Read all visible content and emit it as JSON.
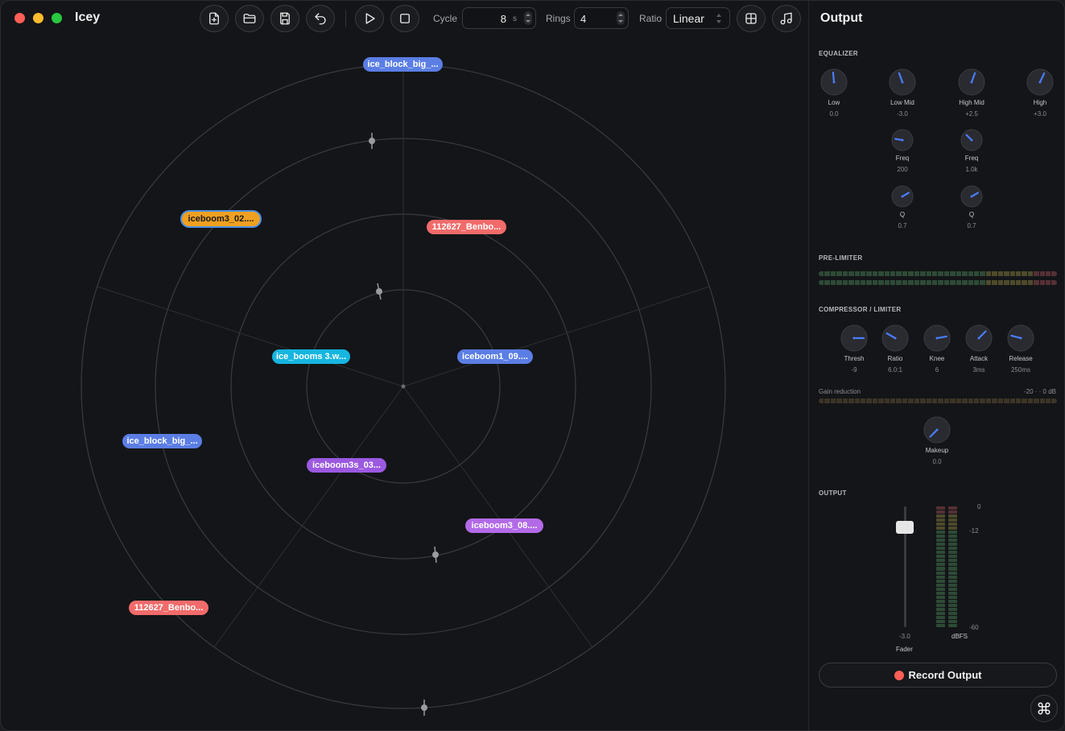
{
  "app": {
    "title": "Icey"
  },
  "toolbar": {
    "new_icon": "file-plus-icon",
    "open_icon": "folder-icon",
    "save_icon": "save-icon",
    "undo_icon": "undo-icon",
    "play_icon": "play-icon",
    "stop_icon": "stop-icon",
    "cycle_label": "Cycle",
    "cycle_value": "8",
    "cycle_unit": "s",
    "rings_label": "Rings",
    "rings_value": "4",
    "ratio_label": "Ratio",
    "ratio_value": "Linear",
    "grid_icon": "grid-icon",
    "music_icon": "music-note-icon"
  },
  "stage": {
    "samples": [
      {
        "label": "ice_block_big_...",
        "color": "#5b7ee5"
      },
      {
        "label": "iceboom3_02....",
        "color": "#f0a020",
        "selected": true
      },
      {
        "label": "112627_Benbo...",
        "color": "#f26b6b"
      },
      {
        "label": "ice_booms 3.w...",
        "color": "#15b6e0"
      },
      {
        "label": "iceboom1_09....",
        "color": "#5b7ee5"
      },
      {
        "label": "ice_block_big_...",
        "color": "#5b7ee5"
      },
      {
        "label": "iceboom3s_03...",
        "color": "#9b59e0"
      },
      {
        "label": "iceboom3_08....",
        "color": "#b36ae8"
      },
      {
        "label": "112627_Benbo...",
        "color": "#f26b6b"
      }
    ]
  },
  "output": {
    "title": "Output",
    "equalizer": {
      "label": "EQUALIZER",
      "knobs": [
        {
          "name": "Low",
          "value": "0.0"
        },
        {
          "name": "Low Mid",
          "value": "-3.0"
        },
        {
          "name": "High Mid",
          "value": "+2.5"
        },
        {
          "name": "High",
          "value": "+3.0"
        },
        {
          "name": "Freq",
          "value": "200"
        },
        {
          "name": "Freq",
          "value": "1.0k"
        },
        {
          "name": "Q",
          "value": "0.7"
        },
        {
          "name": "Q",
          "value": "0.7"
        }
      ]
    },
    "pre_limiter": {
      "label": "PRE-LIMITER"
    },
    "compressor": {
      "label": "COMPRESSOR / LIMITER",
      "knobs": [
        {
          "name": "Thresh",
          "value": "-9"
        },
        {
          "name": "Ratio",
          "value": "6.0:1"
        },
        {
          "name": "Knee",
          "value": "6"
        },
        {
          "name": "Attack",
          "value": "3ms"
        },
        {
          "name": "Release",
          "value": "250ms"
        }
      ],
      "gain_reduction_label": "Gain reduction",
      "gain_reduction_range": "-20 · · 0 dB",
      "makeup": {
        "name": "Makeup",
        "value": "0.0"
      }
    },
    "output_section": {
      "label": "OUTPUT",
      "fader_value": "-3.0",
      "fader_label": "Fader",
      "meter_label": "dBFS",
      "scale": [
        "0",
        "-12",
        "-60"
      ]
    },
    "record_label": "Record Output",
    "corner_icon": "command-icon",
    "colors": {
      "accent": "#4a7dff",
      "record": "#fe5f57"
    }
  }
}
